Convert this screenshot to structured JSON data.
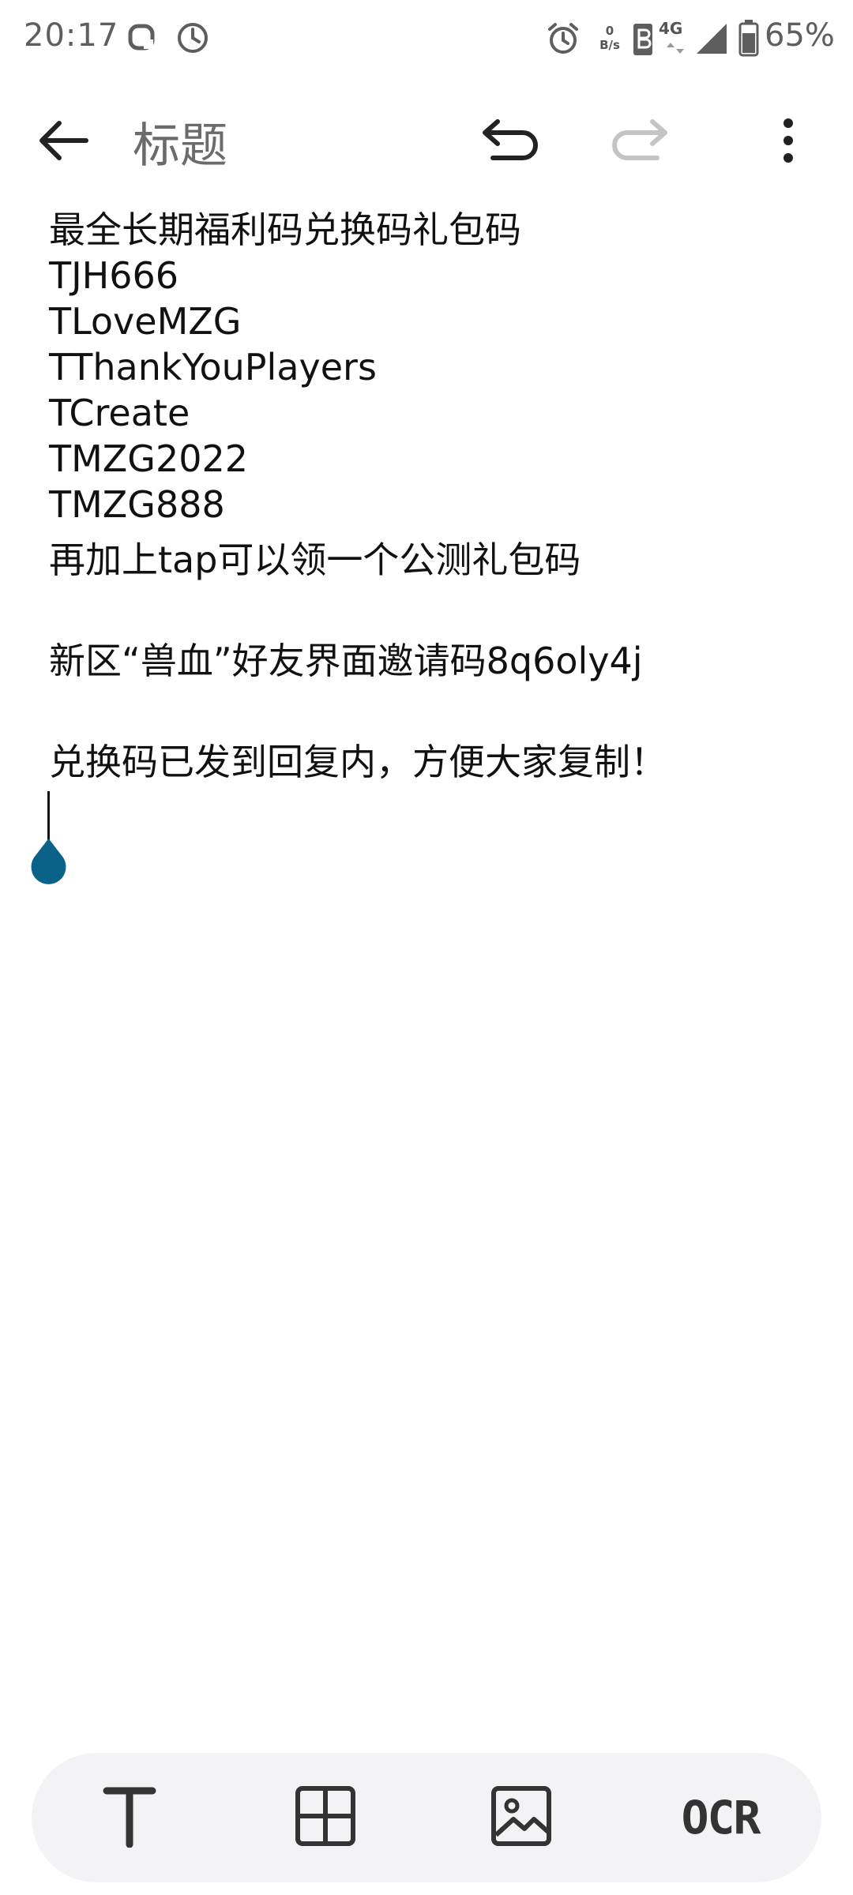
{
  "status_bar": {
    "time": "20:17",
    "net_speed_value": "0",
    "net_speed_unit": "B/s",
    "network_type": "4G",
    "battery": "65%"
  },
  "toolbar": {
    "title_placeholder": "标题",
    "icons": {
      "back": "back-arrow-icon",
      "undo": "undo-icon",
      "redo": "redo-icon",
      "more": "more-vert-icon"
    }
  },
  "note": {
    "lines": [
      "最全长期福利码兑换码礼包码",
      "TJH666",
      "TLoveMZG",
      "TThankYouPlayers",
      "TCreate",
      "TMZG2022",
      "TMZG888",
      "再加上tap可以领一个公测礼包码",
      "",
      "新区“兽血”好友界面邀请码8q6oly4j",
      "",
      "兑换码已发到回复内，方便大家复制！"
    ]
  },
  "bottom_bar": {
    "ocr_label": "OCR",
    "icons": {
      "text_format": "text-format-icon",
      "table": "table-icon",
      "image": "image-icon"
    }
  },
  "colors": {
    "accent": "#0b6289",
    "bottom_bar_bg": "#f3f3f6",
    "icon": "#222222",
    "icon_disabled": "#c4c4c4"
  }
}
